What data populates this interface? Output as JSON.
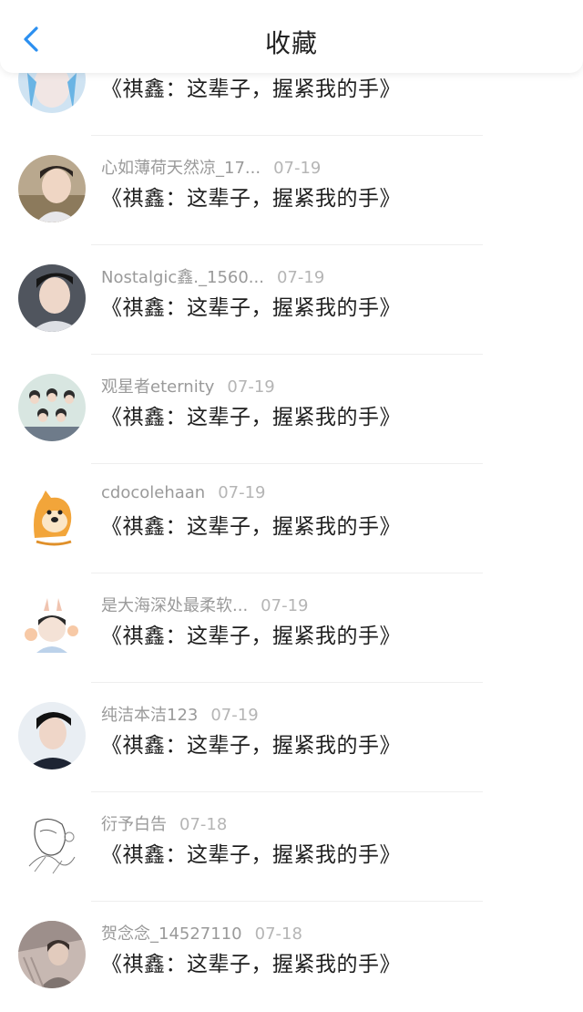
{
  "header": {
    "title": "收藏",
    "back_icon": "chevron-left-icon",
    "accent": "#2b8ff0"
  },
  "items": [
    {
      "author": "",
      "date": "",
      "title": "《祺鑫：这辈子，握紧我的手》",
      "avatar": "blue-hair-portrait"
    },
    {
      "author": "心如薄荷天然凉_17...",
      "date": "07-19",
      "title": "《祺鑫：这辈子，握紧我的手》",
      "avatar": "boy-portrait"
    },
    {
      "author": "Nostalgic鑫._1560...",
      "date": "07-19",
      "title": "《祺鑫：这辈子，握紧我的手》",
      "avatar": "boy-portrait"
    },
    {
      "author": "观星者eternity",
      "date": "07-19",
      "title": "《祺鑫：这辈子，握紧我的手》",
      "avatar": "group-photo"
    },
    {
      "author": "cdocolehaan",
      "date": "07-19",
      "title": "《祺鑫：这辈子，握紧我的手》",
      "avatar": "doge-cartoon"
    },
    {
      "author": "是大海深处最柔软...",
      "date": "07-19",
      "title": "《祺鑫：这辈子，握紧我的手》",
      "avatar": "cartoon-boy"
    },
    {
      "author": "纯洁本洁123",
      "date": "07-19",
      "title": "《祺鑫：这辈子，握紧我的手》",
      "avatar": "boy-portrait-dark"
    },
    {
      "author": "衍予白告",
      "date": "07-18",
      "title": "《祺鑫：这辈子，握紧我的手》",
      "avatar": "sketch-drawing"
    },
    {
      "author": "贺念念_14527110",
      "date": "07-18",
      "title": "《祺鑫：这辈子，握紧我的手》",
      "avatar": "portrait-photo"
    }
  ]
}
